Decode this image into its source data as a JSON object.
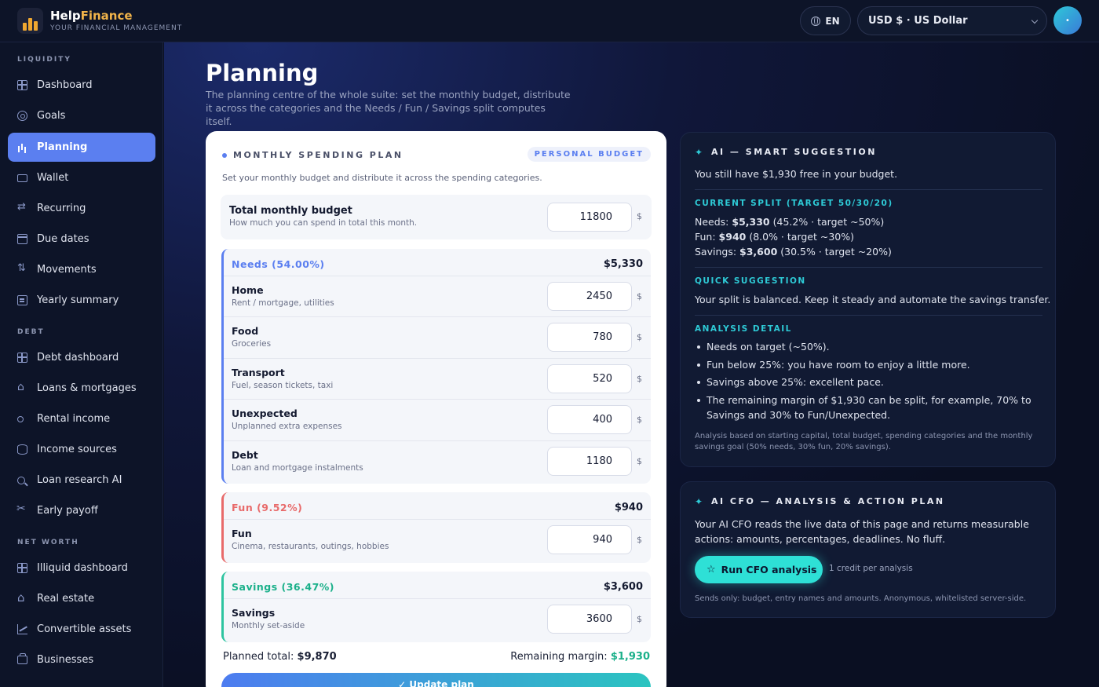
{
  "brand": {
    "name_part1": "Help",
    "name_part2": "Finance",
    "tagline": "YOUR FINANCIAL MANAGEMENT"
  },
  "header": {
    "language": "EN",
    "currency": "USD $ · US Dollar",
    "avatar_label": "•"
  },
  "sidebar": {
    "sections": [
      {
        "title": "LIQUIDITY"
      },
      {
        "title": "DEBT"
      },
      {
        "title": "NET WORTH"
      }
    ],
    "items": [
      {
        "label": "Dashboard",
        "icon": "grid-icon"
      },
      {
        "label": "Goals",
        "icon": "target-icon"
      },
      {
        "label": "Planning",
        "icon": "bar-chart-icon",
        "active": true
      },
      {
        "label": "Wallet",
        "icon": "wallet-icon"
      },
      {
        "label": "Recurring",
        "icon": "repeat-icon"
      },
      {
        "label": "Due dates",
        "icon": "calendar-icon"
      },
      {
        "label": "Movements",
        "icon": "arrows-icon"
      },
      {
        "label": "Yearly summary",
        "icon": "document-icon"
      },
      {
        "label": "Debt dashboard",
        "icon": "grid-icon"
      },
      {
        "label": "Loans & mortgages",
        "icon": "bank-icon"
      },
      {
        "label": "Rental income",
        "icon": "key-icon"
      },
      {
        "label": "Income sources",
        "icon": "database-icon"
      },
      {
        "label": "Loan research AI",
        "icon": "search-icon"
      },
      {
        "label": "Early payoff",
        "icon": "scissors-icon"
      },
      {
        "label": "Illiquid dashboard",
        "icon": "grid-icon"
      },
      {
        "label": "Real estate",
        "icon": "house-icon"
      },
      {
        "label": "Convertible assets",
        "icon": "trend-icon"
      },
      {
        "label": "Businesses",
        "icon": "briefcase-icon"
      }
    ]
  },
  "page": {
    "title": "Planning",
    "description": "The planning centre of the whole suite: set the monthly budget, distribute it across the categories and the Needs / Fun / Savings split computes itself."
  },
  "plan": {
    "heading": "MONTHLY SPENDING PLAN",
    "badge": "PERSONAL BUDGET",
    "description": "Set your monthly budget and distribute it across the spending categories.",
    "total": {
      "title": "Total monthly budget",
      "subtitle": "How much you can spend in total this month.",
      "value": "11800",
      "currency": "$"
    },
    "needs": {
      "label": "Needs (54.00%)",
      "total": "$5,330",
      "color": "#5b7ff0",
      "rows": [
        {
          "name": "Home",
          "sub": "Rent / mortgage, utilities",
          "value": "2450",
          "currency": "$"
        },
        {
          "name": "Food",
          "sub": "Groceries",
          "value": "780",
          "currency": "$"
        },
        {
          "name": "Transport",
          "sub": "Fuel, season tickets, taxi",
          "value": "520",
          "currency": "$"
        },
        {
          "name": "Unexpected",
          "sub": "Unplanned extra expenses",
          "value": "400",
          "currency": "$"
        },
        {
          "name": "Debt",
          "sub": "Loan and mortgage instalments",
          "value": "1180",
          "currency": "$"
        }
      ]
    },
    "fun": {
      "label": "Fun (9.52%)",
      "total": "$940",
      "color": "#e86a6a",
      "rows": [
        {
          "name": "Fun",
          "sub": "Cinema, restaurants, outings, hobbies",
          "value": "940",
          "currency": "$"
        }
      ]
    },
    "savings": {
      "label": "Savings (36.47%)",
      "total": "$3,600",
      "color": "#2ec4a0",
      "rows": [
        {
          "name": "Savings",
          "sub": "Monthly set-aside",
          "value": "3600",
          "currency": "$"
        }
      ]
    },
    "summary": {
      "planned_label": "Planned total:",
      "planned_value": "$9,870",
      "remaining_label": "Remaining margin:",
      "remaining_value": "$1,930"
    },
    "update_button": "✓ Update plan"
  },
  "ai": {
    "title": "AI — SMART SUGGESTION",
    "free_text": "You still have $1,930 free in your budget.",
    "split_title": "CURRENT SPLIT (TARGET 50/30/20)",
    "split": [
      {
        "label": "Needs:",
        "value": "$5,330",
        "detail": "(45.2% · target ~50%)"
      },
      {
        "label": "Fun:",
        "value": "$940",
        "detail": "(8.0% · target ~30%)"
      },
      {
        "label": "Savings:",
        "value": "$3,600",
        "detail": "(30.5% · target ~20%)"
      }
    ],
    "quick_title": "QUICK SUGGESTION",
    "quick_text": "Your split is balanced. Keep it steady and automate the savings transfer.",
    "analysis_title": "ANALYSIS DETAIL",
    "analysis": [
      "Needs on target (~50%).",
      "Fun below 25%: you have room to enjoy a little more.",
      "Savings above 25%: excellent pace.",
      "The remaining margin of $1,930 can be split, for example, 70% to Savings and 30% to Fun/Unexpected."
    ],
    "note": "Analysis based on starting capital, total budget, spending categories and the monthly savings goal (50% needs, 30% fun, 20% savings)."
  },
  "cfo": {
    "title": "AI CFO — ANALYSIS & ACTION PLAN",
    "text": "Your AI CFO reads the live data of this page and returns measurable actions: amounts, percentages, deadlines. No fluff.",
    "button": "Run CFO analysis",
    "credit": "1 credit per analysis",
    "note": "Sends only: budget, entry names and amounts. Anonymous, whitelisted server-side."
  },
  "colors": {
    "accent": "#5b7ff0",
    "teal": "#2ecad6",
    "brand_gold": "#f0b34a",
    "positive": "#1bb08a"
  }
}
